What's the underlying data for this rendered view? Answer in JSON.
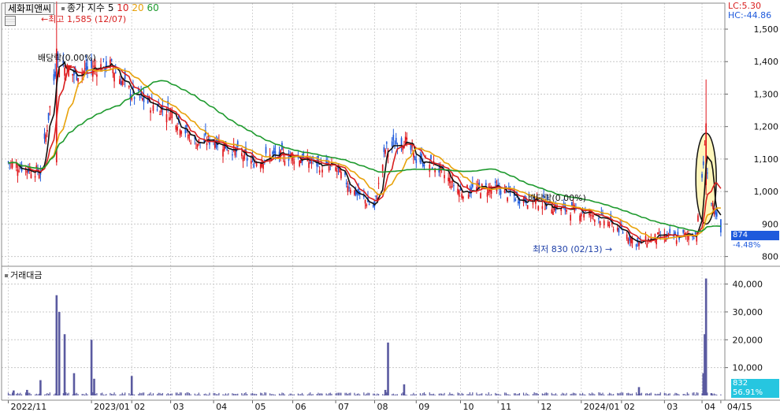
{
  "header": {
    "stock_name": "세화피앤씨",
    "indicator_label": "종가 지수",
    "ma_periods": [
      "5",
      "10",
      "20",
      "60"
    ],
    "lc_text": "LC:5.30",
    "hc_text": "HC:-44.86"
  },
  "price_panel": {
    "high_annotation": "최고 1,585 (12/07)",
    "low_annotation": "최저 830 (02/13)",
    "dividend_labels": [
      "배당락(0.00%)",
      "배당락(0.00%)"
    ],
    "current_price": "874",
    "change_pct": "-4.48%"
  },
  "volume_panel": {
    "title": "거래대금",
    "current_value": "832",
    "change_pct": "56.91%"
  },
  "colors": {
    "up": "#e0161b",
    "down": "#1e5adc",
    "ma5": "#111111",
    "ma10": "#d81e1e",
    "ma20": "#e8a20a",
    "ma60": "#1e9a2e",
    "volume": "#5a5aa0",
    "highlight_fill": "#fff6b0"
  },
  "chart_data": [
    {
      "type": "candlestick",
      "title": "세화피앤씨",
      "y_ticks": [
        800,
        900,
        1000,
        1100,
        1200,
        1300,
        1400,
        1500
      ],
      "y_tick_labels": [
        "800",
        "900",
        "1,000",
        "1,100",
        "1,200",
        "1,300",
        "1,400",
        "1,500"
      ],
      "ylim": [
        770,
        1580
      ],
      "moving_averages": [
        "5",
        "10",
        "20",
        "60"
      ],
      "close_series": {
        "x": [
          "2022-11-01",
          "2022-11-15",
          "2022-11-25",
          "2022-12-07",
          "2022-12-20",
          "2023-01-03",
          "2023-01-16",
          "2023-02-01",
          "2023-02-15",
          "2023-03-01",
          "2023-03-20",
          "2023-04-03",
          "2023-04-17",
          "2023-05-02",
          "2023-05-16",
          "2023-06-01",
          "2023-06-15",
          "2023-07-03",
          "2023-07-17",
          "2023-08-01",
          "2023-08-09",
          "2023-08-23",
          "2023-09-01",
          "2023-09-15",
          "2023-10-04",
          "2023-10-18",
          "2023-11-01",
          "2023-11-15",
          "2023-12-01",
          "2023-12-15",
          "2024-01-02",
          "2024-01-16",
          "2024-02-01",
          "2024-02-13",
          "2024-02-28",
          "2024-03-13",
          "2024-03-28",
          "2024-04-03",
          "2024-04-08",
          "2024-04-15"
        ],
        "close": [
          1090,
          1070,
          1060,
          1400,
          1360,
          1380,
          1390,
          1300,
          1270,
          1250,
          1150,
          1160,
          1130,
          1090,
          1110,
          1110,
          1090,
          1070,
          1000,
          950,
          1130,
          1160,
          1100,
          1080,
          1000,
          1010,
          1010,
          980,
          970,
          950,
          940,
          920,
          880,
          840,
          860,
          860,
          870,
          1130,
          960,
          874
        ]
      },
      "high": {
        "value": 1585,
        "date": "12/07"
      },
      "low": {
        "value": 830,
        "date": "02/13"
      },
      "last": 874
    },
    {
      "type": "bar",
      "title": "거래대금",
      "y_ticks": [
        10000,
        20000,
        30000,
        40000
      ],
      "y_tick_labels": [
        "10,000",
        "20,000",
        "30,000",
        "40,000"
      ],
      "ylim": [
        0,
        43000
      ],
      "x": [
        "2022-11-05",
        "2022-11-15",
        "2022-11-25",
        "2022-12-07",
        "2022-12-09",
        "2022-12-13",
        "2022-12-20",
        "2023-01-02",
        "2023-01-04",
        "2023-02-01",
        "2023-08-09",
        "2023-08-11",
        "2023-08-23",
        "2024-02-14",
        "2024-04-02",
        "2024-04-03",
        "2024-04-04",
        "2024-04-08"
      ],
      "values": [
        1800,
        2000,
        5500,
        36000,
        30000,
        22000,
        8000,
        20000,
        6000,
        7000,
        2000,
        19000,
        4000,
        3000,
        8000,
        22000,
        42000,
        832
      ]
    }
  ],
  "x_axis": {
    "labels": [
      "2022/11",
      "2023/01",
      "02",
      "03",
      "04",
      "05",
      "06",
      "07",
      "08",
      "09",
      "10",
      "11",
      "12",
      "2024/01",
      "02",
      "03",
      "04",
      "04/15"
    ]
  }
}
